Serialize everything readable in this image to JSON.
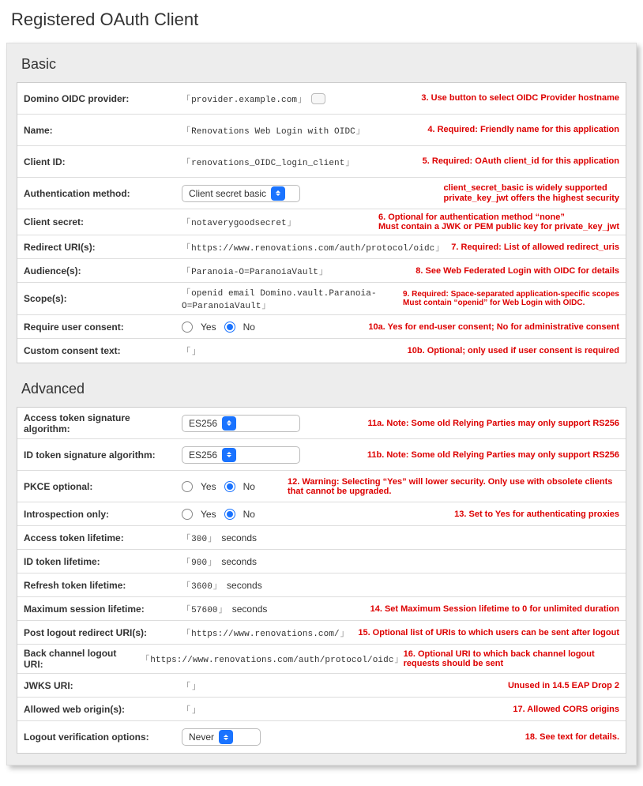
{
  "page_title": "Registered OAuth Client",
  "sections": {
    "basic": {
      "title": "Basic",
      "oidc_provider": {
        "label": "Domino OIDC provider:",
        "value": "provider.example.com",
        "note": "3. Use button to select OIDC Provider hostname"
      },
      "name": {
        "label": "Name:",
        "value": "Renovations Web Login with OIDC",
        "note": "4. Required: Friendly name for this application"
      },
      "client_id": {
        "label": "Client ID:",
        "value": "renovations_OIDC_login_client",
        "note": "5. Required: OAuth client_id for this application"
      },
      "auth_method": {
        "label": "Authentication method:",
        "selected": "Client secret basic",
        "note": "client_secret_basic is widely supported\nprivate_key_jwt offers the highest security"
      },
      "client_secret": {
        "label": "Client secret:",
        "value": "notaverygoodsecret",
        "note": "6. Optional for authentication method “none”\nMust contain a JWK or PEM public key for private_key_jwt"
      },
      "redirect_uris": {
        "label": "Redirect URI(s):",
        "value": "https://www.renovations.com/auth/protocol/oidc",
        "note": "7. Required: List of allowed redirect_uris"
      },
      "audiences": {
        "label": "Audience(s):",
        "value": "Paranoia-O=ParanoiaVault",
        "note": "8. See Web Federated Login with OIDC for details"
      },
      "scopes": {
        "label": "Scope(s):",
        "value": "openid email Domino.vault.Paranoia-O=ParanoiaVault",
        "note": "9. Required: Space-separated application-specific scopes\nMust contain “openid” for Web Login with OIDC."
      },
      "require_consent": {
        "label": "Require user consent:",
        "yes": "Yes",
        "no": "No",
        "selected": "No",
        "note": "10a. Yes for end-user consent; No for administrative consent"
      },
      "consent_text": {
        "label": "Custom consent text:",
        "value": "",
        "note": "10b. Optional; only used if user consent is required"
      }
    },
    "advanced": {
      "title": "Advanced",
      "access_alg": {
        "label": "Access token signature algorithm:",
        "selected": "ES256",
        "note": "11a. Note: Some old Relying Parties may only support RS256"
      },
      "id_alg": {
        "label": "ID token signature algorithm:",
        "selected": "ES256",
        "note": "11b. Note: Some old Relying Parties may only support RS256"
      },
      "pkce": {
        "label": "PKCE optional:",
        "yes": "Yes",
        "no": "No",
        "selected": "No",
        "note": "12. Warning: Selecting “Yes” will lower security. Only use with obsolete clients that cannot be upgraded."
      },
      "introspect": {
        "label": "Introspection only:",
        "yes": "Yes",
        "no": "No",
        "selected": "No",
        "note": "13. Set to Yes for authenticating proxies"
      },
      "access_life": {
        "label": "Access token lifetime:",
        "value": "300",
        "units": "seconds"
      },
      "id_life": {
        "label": "ID token lifetime:",
        "value": "900",
        "units": "seconds"
      },
      "refresh_life": {
        "label": "Refresh token lifetime:",
        "value": "3600",
        "units": "seconds"
      },
      "max_session": {
        "label": "Maximum session lifetime:",
        "value": "57600",
        "units": "seconds",
        "note": "14. Set Maximum Session lifetime to 0 for unlimited duration"
      },
      "post_logout": {
        "label": "Post logout redirect URI(s):",
        "value": "https://www.renovations.com/",
        "note": "15. Optional list of URIs to which users can be sent after logout"
      },
      "back_channel": {
        "label": "Back channel logout URI:",
        "value": "https://www.renovations.com/auth/protocol/oidc",
        "note": "16. Optional URI to which back channel logout requests should be sent"
      },
      "jwks_uri": {
        "label": "JWKS URI:",
        "value": "",
        "note": "Unused in 14.5 EAP Drop 2"
      },
      "web_origins": {
        "label": "Allowed web origin(s):",
        "value": "",
        "note": "17. Allowed CORS origins"
      },
      "logout_verify": {
        "label": "Logout verification options:",
        "selected": "Never",
        "note": "18. See text for details."
      }
    }
  }
}
